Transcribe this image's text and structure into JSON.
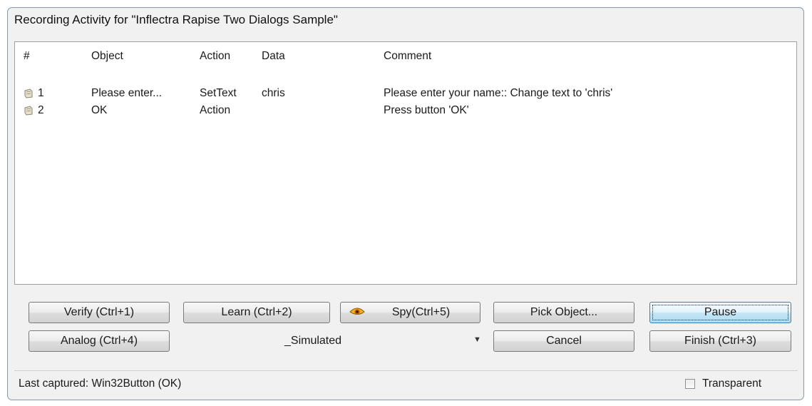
{
  "window": {
    "title": "Recording Activity for \"Inflectra Rapise Two Dialogs Sample\""
  },
  "table": {
    "columns": [
      "#",
      "Object",
      "Action",
      "Data",
      "Comment"
    ],
    "rows": [
      {
        "num": "1",
        "object": "Please enter...",
        "action": "SetText",
        "data": "chris",
        "comment": "Please enter your name:: Change text to 'chris'"
      },
      {
        "num": "2",
        "object": "OK",
        "action": "Action",
        "data": "",
        "comment": "Press button 'OK'"
      }
    ]
  },
  "buttons": {
    "verify": "Verify (Ctrl+1)",
    "learn": "Learn (Ctrl+2)",
    "spy": "Spy(Ctrl+5)",
    "pick": "Pick Object...",
    "pause": "Pause",
    "analog": "Analog (Ctrl+4)",
    "cancel": "Cancel",
    "finish": "Finish (Ctrl+3)"
  },
  "mode_select": {
    "value": "_Simulated"
  },
  "status": {
    "text": "Last captured: Win32Button (OK)",
    "transparent_label": "Transparent",
    "transparent_checked": false
  },
  "icons": {
    "row_icon": "record-step-icon",
    "spy_icon": "eye-icon",
    "combo_icon": "dropdown-arrow-icon"
  }
}
